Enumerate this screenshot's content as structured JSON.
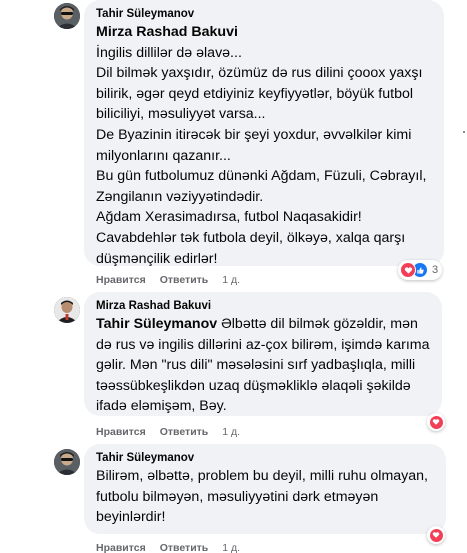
{
  "comments": [
    {
      "author": "Tahir Süleymanov",
      "mention": "Mirza Rashad Bakuvi",
      "text": "İngilis dillilər də əlavə...\nDil bilmək yaxşıdır, özümüz də rus dilini çooox yaxşı bilirik, əgər qeyd etdiyiniz keyfiyyətlər, böyük futbol biliciliyi, məsuliyyət varsa...\nDe Byazinin itirəcək bir şeyi yoxdur, əvvəlkilər kimi milyonlarını qazanır...\nBu gün futbolumuz dünənki Ağdam, Füzuli, Cəbrayıl, Zəngilanın vəziyyətindədir.\nAğdam Xerasimadırsa, futbol Naqasakidir!\nCavabdehlər tək futbola deyil, ölkəyə, xalqa qarşı düşmənçilik edirlər!",
      "like_label": "Нравится",
      "reply_label": "Ответить",
      "time": "1 д.",
      "reactions": {
        "icons": [
          "love-icon",
          "like-icon"
        ],
        "count": "3"
      }
    },
    {
      "author": "Mirza Rashad Bakuvi",
      "mention": "Tahir Süleymanov",
      "text": "Əlbəttə dil bilmək gözəldir, mən də rus və ingilis dillərini az-çox bilirəm, işimdə karıma gəlir. Mən \"rus dili\" məsələsini sırf yadbaşlıqla, milli təəssübkeşlikdən uzaq düşməkliklə əlaqəli şəkildə ifadə eləmişəm, Bəy.",
      "like_label": "Нравится",
      "reply_label": "Ответить",
      "time": "1 д.",
      "reactions": {
        "icons": [
          "love-icon"
        ]
      }
    },
    {
      "author": "Tahir Süleymanov",
      "text": "Bilirəm, əlbəttə, problem bu deyil, milli ruhu olmayan, futbolu bilməyən, məsuliyyətini dərk etməyən beyinlərdir!",
      "like_label": "Нравится",
      "reply_label": "Ответить",
      "time": "1 д.",
      "reactions": {
        "icons": [
          "love-icon"
        ]
      }
    }
  ],
  "colors": {
    "bubble": "#f0f2f5",
    "meta": "#65676b",
    "love": "#f33e58",
    "like": "#1877f2"
  }
}
